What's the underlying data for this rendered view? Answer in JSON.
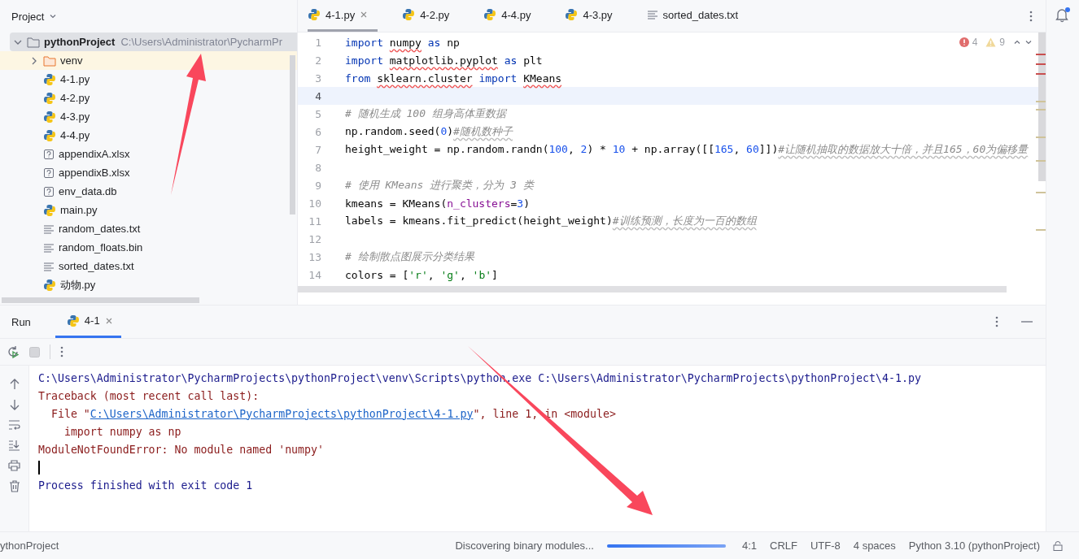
{
  "project_panel": {
    "title": "Project",
    "tree": [
      {
        "name": "pythonProject",
        "path": "C:\\Users\\Administrator\\PycharmPr",
        "kind": "folder",
        "expanded": true,
        "selected": true,
        "children": [
          {
            "name": "venv",
            "kind": "folder",
            "expanded": false,
            "selected": false,
            "highlighted": true
          },
          {
            "name": "4-1.py",
            "kind": "python",
            "selected": false,
            "highlighted": false
          },
          {
            "name": "4-2.py",
            "kind": "python",
            "selected": false,
            "highlighted": false
          },
          {
            "name": "4-3.py",
            "kind": "python",
            "selected": false,
            "highlighted": false
          },
          {
            "name": "4-4.py",
            "kind": "python",
            "selected": false,
            "highlighted": false
          },
          {
            "name": "appendixA.xlsx",
            "kind": "unknown",
            "selected": false,
            "highlighted": false
          },
          {
            "name": "appendixB.xlsx",
            "kind": "unknown",
            "selected": false,
            "highlighted": false
          },
          {
            "name": "env_data.db",
            "kind": "unknown",
            "selected": false,
            "highlighted": false
          },
          {
            "name": "main.py",
            "kind": "python",
            "selected": false,
            "highlighted": false
          },
          {
            "name": "random_dates.txt",
            "kind": "text",
            "selected": false,
            "highlighted": false
          },
          {
            "name": "random_floats.bin",
            "kind": "text",
            "selected": false,
            "highlighted": false
          },
          {
            "name": "sorted_dates.txt",
            "kind": "text",
            "selected": false,
            "highlighted": false
          },
          {
            "name": "动物.py",
            "kind": "python",
            "selected": false,
            "highlighted": false
          }
        ]
      }
    ]
  },
  "editor": {
    "tabs": [
      {
        "label": "4-1.py",
        "kind": "python",
        "selected": true,
        "closable": true
      },
      {
        "label": "4-2.py",
        "kind": "python",
        "selected": false,
        "closable": false
      },
      {
        "label": "4-4.py",
        "kind": "python",
        "selected": false,
        "closable": false
      },
      {
        "label": "4-3.py",
        "kind": "python",
        "selected": false,
        "closable": false
      },
      {
        "label": "sorted_dates.txt",
        "kind": "text",
        "selected": false,
        "closable": false
      }
    ],
    "inspections": {
      "errors": "4",
      "warnings": "9"
    },
    "lines": [
      {
        "number": "1",
        "current": false,
        "tokens": [
          {
            "text": "import",
            "kind": "keyword"
          },
          {
            "text": " numpy ",
            "kind": "unresolved"
          },
          {
            "text": "as",
            "kind": "keyword"
          },
          {
            "text": " np",
            "kind": "plain"
          }
        ]
      },
      {
        "number": "2",
        "current": false,
        "tokens": [
          {
            "text": "import",
            "kind": "keyword"
          },
          {
            "text": " matplotlib.pyplot ",
            "kind": "unresolved"
          },
          {
            "text": "as",
            "kind": "keyword"
          },
          {
            "text": " plt",
            "kind": "plain"
          }
        ]
      },
      {
        "number": "3",
        "current": false,
        "tokens": [
          {
            "text": "from",
            "kind": "keyword"
          },
          {
            "text": " sklearn.cluster ",
            "kind": "unresolved"
          },
          {
            "text": "import",
            "kind": "keyword"
          },
          {
            "text": " KMeans",
            "kind": "unresolved"
          }
        ]
      },
      {
        "number": "4",
        "current": true
      },
      {
        "number": "5",
        "current": false,
        "tokens": [
          {
            "text": "# 随机生成 100 组身高体重数据",
            "kind": "comment"
          }
        ]
      },
      {
        "number": "6",
        "current": false,
        "tokens": [
          {
            "text": "np.random.seed(",
            "kind": "plain"
          },
          {
            "text": "0",
            "kind": "number"
          },
          {
            "text": ")",
            "kind": "plain"
          },
          {
            "text": "#随机数种子",
            "kind": "typocomment"
          }
        ]
      },
      {
        "number": "7",
        "current": false,
        "tokens": [
          {
            "text": "height_weight = np.random.randn(",
            "kind": "plain"
          },
          {
            "text": "100",
            "kind": "number"
          },
          {
            "text": ", ",
            "kind": "plain"
          },
          {
            "text": "2",
            "kind": "number"
          },
          {
            "text": ") * ",
            "kind": "plain"
          },
          {
            "text": "10",
            "kind": "number"
          },
          {
            "text": " + np.array([[",
            "kind": "plain"
          },
          {
            "text": "165",
            "kind": "number"
          },
          {
            "text": ", ",
            "kind": "plain"
          },
          {
            "text": "60",
            "kind": "number"
          },
          {
            "text": "]])",
            "kind": "plain"
          },
          {
            "text": "#让随机抽取的数据放大十倍，并且165，60为偏移量",
            "kind": "typocomment"
          }
        ]
      },
      {
        "number": "8",
        "current": false
      },
      {
        "number": "9",
        "current": false,
        "tokens": [
          {
            "text": "# 使用 KMeans 进行聚类，分为 3 类",
            "kind": "comment"
          }
        ]
      },
      {
        "number": "10",
        "current": false,
        "tokens": [
          {
            "text": "kmeans = KMeans(",
            "kind": "plain"
          },
          {
            "text": "n_clusters",
            "kind": "param"
          },
          {
            "text": "=",
            "kind": "plain"
          },
          {
            "text": "3",
            "kind": "number"
          },
          {
            "text": ")",
            "kind": "plain"
          }
        ]
      },
      {
        "number": "11",
        "current": false,
        "tokens": [
          {
            "text": "labels = kmeans.fit_predict(height_weight)",
            "kind": "plain"
          },
          {
            "text": "#训练预测，长度为一百的数组",
            "kind": "typocomment"
          }
        ]
      },
      {
        "number": "12",
        "current": false
      },
      {
        "number": "13",
        "current": false,
        "tokens": [
          {
            "text": "# 绘制散点图展示分类结果",
            "kind": "comment"
          }
        ]
      },
      {
        "number": "14",
        "current": false,
        "tokens": [
          {
            "text": "colors = [",
            "kind": "plain"
          },
          {
            "text": "'r'",
            "kind": "string"
          },
          {
            "text": ", ",
            "kind": "plain"
          },
          {
            "text": "'g'",
            "kind": "string"
          },
          {
            "text": ", ",
            "kind": "plain"
          },
          {
            "text": "'b'",
            "kind": "string"
          },
          {
            "text": "]",
            "kind": "plain"
          }
        ]
      }
    ]
  },
  "run_panel": {
    "title": "Run",
    "tabs": [
      {
        "label": "4-1",
        "selected": true
      }
    ],
    "output": [
      {
        "kind": "command",
        "parts": [
          {
            "text": "C:\\Users\\Administrator\\PycharmProjects\\pythonProject\\venv\\Scripts\\python.exe C:\\Users\\Administrator\\PycharmProjects\\pythonProject\\4-1.py",
            "link": false
          }
        ]
      },
      {
        "kind": "error",
        "parts": [
          {
            "text": "Traceback (most recent call last):",
            "link": false
          }
        ]
      },
      {
        "kind": "error",
        "parts": [
          {
            "text": "  File \"",
            "link": false
          },
          {
            "text": "C:\\Users\\Administrator\\PycharmProjects\\pythonProject\\4-1.py",
            "link": true
          },
          {
            "text": "\", line 1, in <module>",
            "link": false
          }
        ]
      },
      {
        "kind": "error",
        "parts": [
          {
            "text": "    import numpy as np",
            "link": false
          }
        ]
      },
      {
        "kind": "error",
        "parts": [
          {
            "text": "ModuleNotFoundError: No module named 'numpy'",
            "link": false
          }
        ]
      },
      {
        "kind": "cursor"
      },
      {
        "kind": "command",
        "parts": [
          {
            "text": "Process finished with exit code 1",
            "link": false
          }
        ]
      }
    ]
  },
  "status_bar": {
    "project": "ythonProject",
    "task": "Discovering binary modules...",
    "progress": {
      "level": 1
    },
    "items": [
      "4:1",
      "CRLF",
      "UTF-8",
      "4 spaces",
      "Python 3.10 (pythonProject)"
    ]
  }
}
